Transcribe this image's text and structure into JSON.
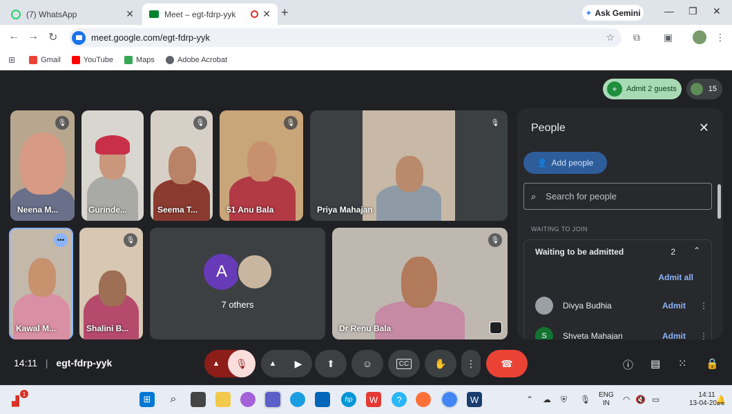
{
  "browser": {
    "tabs": [
      {
        "title": "(7) WhatsApp"
      },
      {
        "title": "Meet – egt-fdrp-yyk"
      }
    ],
    "ask_gemini": "Ask Gemini",
    "url": "meet.google.com/egt-fdrp-yyk",
    "bookmarks": [
      "Gmail",
      "YouTube",
      "Maps",
      "Adobe Acrobat"
    ]
  },
  "meet": {
    "admit_button": "Admit 2 guests",
    "participant_count": "15",
    "tiles": [
      {
        "name": "Neena M..."
      },
      {
        "name": "Gurinde..."
      },
      {
        "name": "Seema T..."
      },
      {
        "name": "51 Anu Bala"
      },
      {
        "name": "Priya Mahajan"
      },
      {
        "name": "Kawal M..."
      },
      {
        "name": "Shalini B..."
      },
      {
        "name": "7 others",
        "avatar_letter": "A"
      },
      {
        "name": "Dr Renu Bala"
      }
    ],
    "people_panel": {
      "title": "People",
      "add_people": "Add people",
      "search_placeholder": "Search for people",
      "section_label": "WAITING TO JOIN",
      "waiting_header": "Waiting to be admitted",
      "waiting_count": "2",
      "admit_all": "Admit all",
      "waiting": [
        {
          "name": "Divya Budhia",
          "action": "Admit"
        },
        {
          "name": "Shveta Mahajan",
          "action": "Admit",
          "initial": "S"
        }
      ]
    },
    "bottom": {
      "time": "14:11",
      "meeting_code": "egt-fdrp-yyk"
    }
  },
  "taskbar": {
    "notification_badge": "1",
    "lang_line1": "ENG",
    "lang_line2": "IN",
    "clock_time": "14:11",
    "clock_date": "13-04-2026"
  }
}
